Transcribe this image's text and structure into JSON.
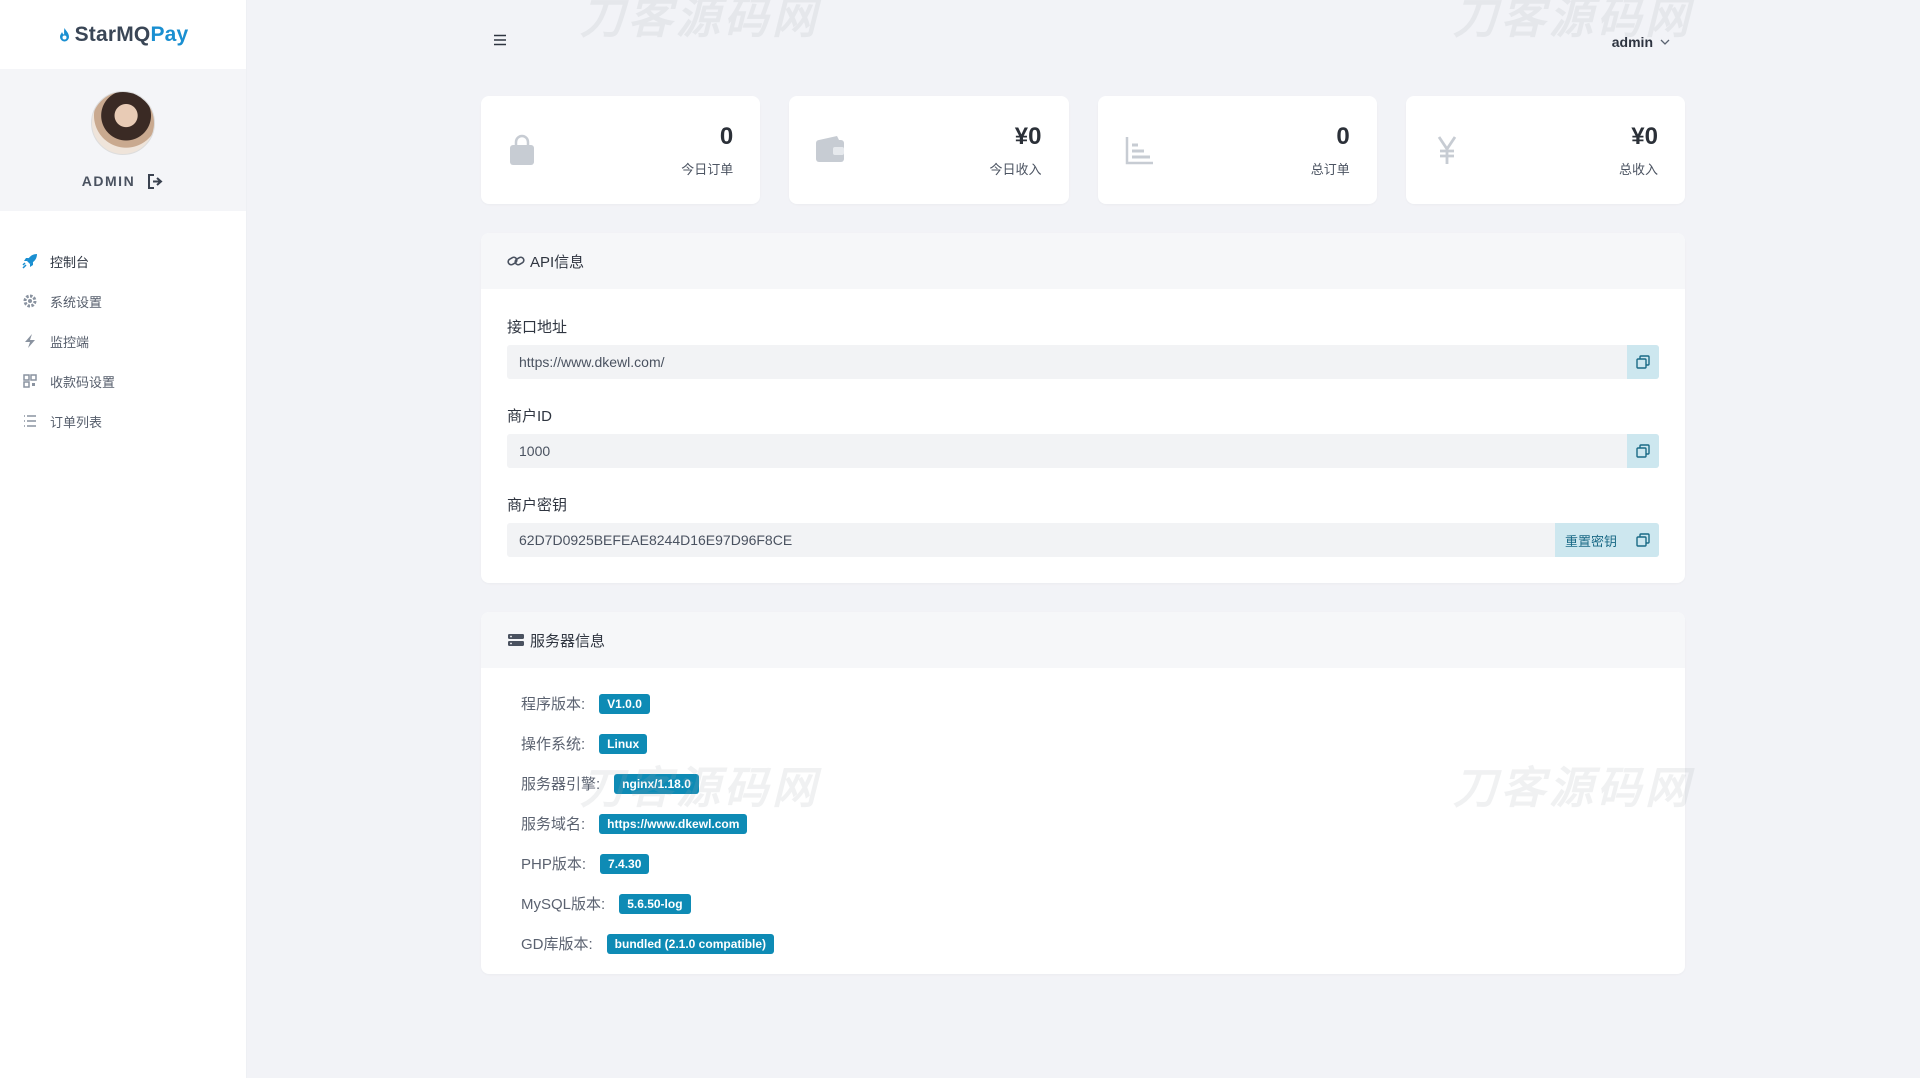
{
  "brand": {
    "name_main": "StarMQ",
    "name_accent": "Pay"
  },
  "profile": {
    "name": "ADMIN"
  },
  "nav": [
    {
      "label": "控制台",
      "icon": "rocket-icon"
    },
    {
      "label": "系统设置",
      "icon": "gear-icon"
    },
    {
      "label": "监控端",
      "icon": "bolt-icon"
    },
    {
      "label": "收款码设置",
      "icon": "qrcode-icon"
    },
    {
      "label": "订单列表",
      "icon": "list-icon"
    }
  ],
  "header": {
    "user": "admin"
  },
  "stats": [
    {
      "value": "0",
      "label": "今日订单",
      "icon": "bag-icon"
    },
    {
      "value": "¥0",
      "label": "今日收入",
      "icon": "wallet-icon"
    },
    {
      "value": "0",
      "label": "总订单",
      "icon": "chart-icon"
    },
    {
      "value": "¥0",
      "label": "总收入",
      "icon": "yen-icon"
    }
  ],
  "api": {
    "title": "API信息",
    "url_label": "接口地址",
    "url_value": "https://www.dkewl.com/",
    "merchant_id_label": "商户ID",
    "merchant_id_value": "1000",
    "key_label": "商户密钥",
    "key_value": "62D7D0925BEFEAE8244D16E97D96F8CE",
    "reset_label": "重置密钥"
  },
  "server": {
    "title": "服务器信息",
    "rows": [
      {
        "label": "程序版本:",
        "value": "V1.0.0"
      },
      {
        "label": "操作系统:",
        "value": "Linux"
      },
      {
        "label": "服务器引擎:",
        "value": "nginx/1.18.0"
      },
      {
        "label": "服务域名:",
        "value": "https://www.dkewl.com"
      },
      {
        "label": "PHP版本:",
        "value": "7.4.30"
      },
      {
        "label": "MySQL版本:",
        "value": "5.6.50-log"
      },
      {
        "label": "GD库版本:",
        "value": "bundled (2.1.0 compatible)"
      }
    ]
  },
  "watermark": "刀客源码网",
  "colors": {
    "accent": "#1a8fd1",
    "badge": "#0e8bb5",
    "copy_bg": "#cde7ef"
  }
}
